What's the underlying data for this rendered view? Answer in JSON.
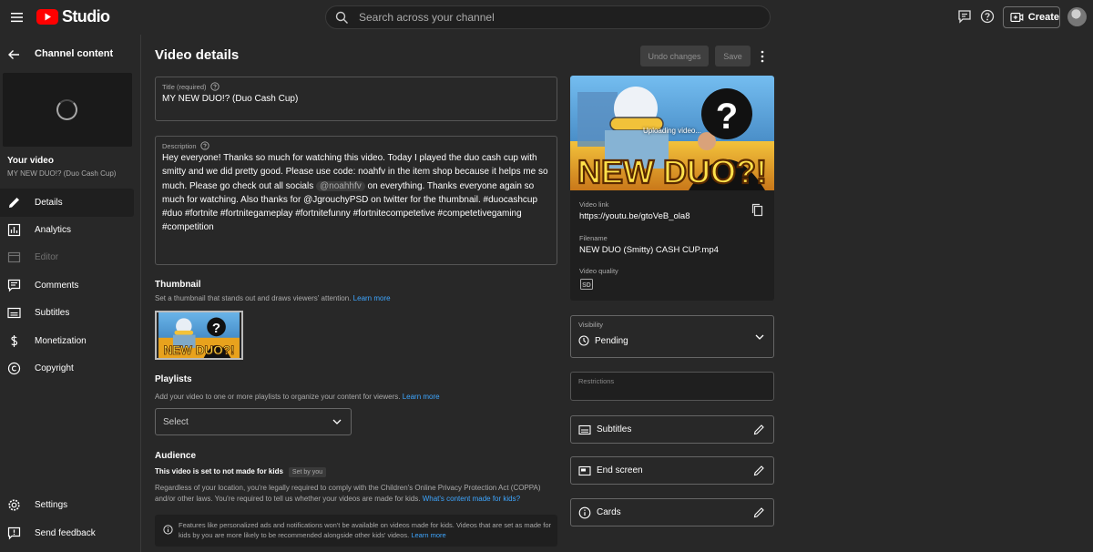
{
  "app": {
    "logo_text": "Studio"
  },
  "search": {
    "placeholder": "Search across your channel"
  },
  "topbar": {
    "create_label": "Create"
  },
  "sidebar": {
    "back_title": "Channel content",
    "your_video_label": "Your video",
    "video_name": "MY NEW DUO!? (Duo Cash Cup)",
    "items": [
      {
        "label": "Details",
        "icon": "pencil-icon",
        "active": true
      },
      {
        "label": "Analytics",
        "icon": "analytics-icon"
      },
      {
        "label": "Editor",
        "icon": "editor-icon",
        "disabled": true
      },
      {
        "label": "Comments",
        "icon": "comments-icon"
      },
      {
        "label": "Subtitles",
        "icon": "subtitles-icon"
      },
      {
        "label": "Monetization",
        "icon": "dollar-icon"
      },
      {
        "label": "Copyright",
        "icon": "copyright-icon"
      }
    ],
    "bottom": [
      {
        "label": "Settings",
        "icon": "gear-icon"
      },
      {
        "label": "Send feedback",
        "icon": "feedback-icon"
      }
    ]
  },
  "page": {
    "title": "Video details",
    "undo_label": "Undo changes",
    "save_label": "Save"
  },
  "title_field": {
    "label": "Title (required)",
    "value": "MY NEW DUO!? (Duo Cash Cup)"
  },
  "description_field": {
    "label": "Description",
    "text_before_mention": "Hey everyone! Thanks so much for watching this video. Today I played the duo cash cup with smitty and we did pretty good. Please use code: noahfv in the item shop because it helps me so much. Please go check out all socials ",
    "mention": "@noahhfv",
    "text_after_mention": " on everything. Thanks everyone again so much for watching. Also thanks for @JgrouchyPSD on twitter for the thumbnail. #duocashcup #duo #fortnite #fortnitegameplay #fortnitefunny #fortnitecompetetive #competetivegaming #competition"
  },
  "thumbnail": {
    "title": "Thumbnail",
    "subtitle": "Set a thumbnail that stands out and draws viewers' attention.",
    "learn_more": "Learn more",
    "image_text": "NEW DUO?!"
  },
  "playlists": {
    "title": "Playlists",
    "subtitle": "Add your video to one or more playlists to organize your content for viewers.",
    "learn_more": "Learn more",
    "select_label": "Select"
  },
  "audience": {
    "title": "Audience",
    "status": "This video is set to not made for kids",
    "badge": "Set by you",
    "body": "Regardless of your location, you're legally required to comply with the Children's Online Privacy Protection Act (COPPA) and/or other laws. You're required to tell us whether your videos are made for kids.",
    "link": "What's content made for kids?",
    "notice": "Features like personalized ads and notifications won't be available on videos made for kids. Videos that are set as made for kids by you are more likely to be recommended alongside other kids' videos.",
    "notice_link": "Learn more"
  },
  "preview": {
    "uploading_text": "Uploading video...",
    "image_text": "NEW DUO?!",
    "video_link_label": "Video link",
    "video_link": "https://youtu.be/gtoVeB_ola8",
    "filename_label": "Filename",
    "filename": "NEW DUO (Smitty) CASH CUP.mp4",
    "quality_label": "Video quality",
    "quality_badge": "SD"
  },
  "visibility": {
    "label": "Visibility",
    "value": "Pending"
  },
  "restrictions": {
    "label": "Restrictions"
  },
  "extras": [
    {
      "label": "Subtitles",
      "icon": "subtitles-icon"
    },
    {
      "label": "End screen",
      "icon": "end-screen-icon"
    },
    {
      "label": "Cards",
      "icon": "info-icon"
    }
  ],
  "colors": {
    "background": "#282828",
    "surface": "#1f1f1f",
    "link": "#3ea6ff",
    "brand_red": "#ff0000"
  }
}
